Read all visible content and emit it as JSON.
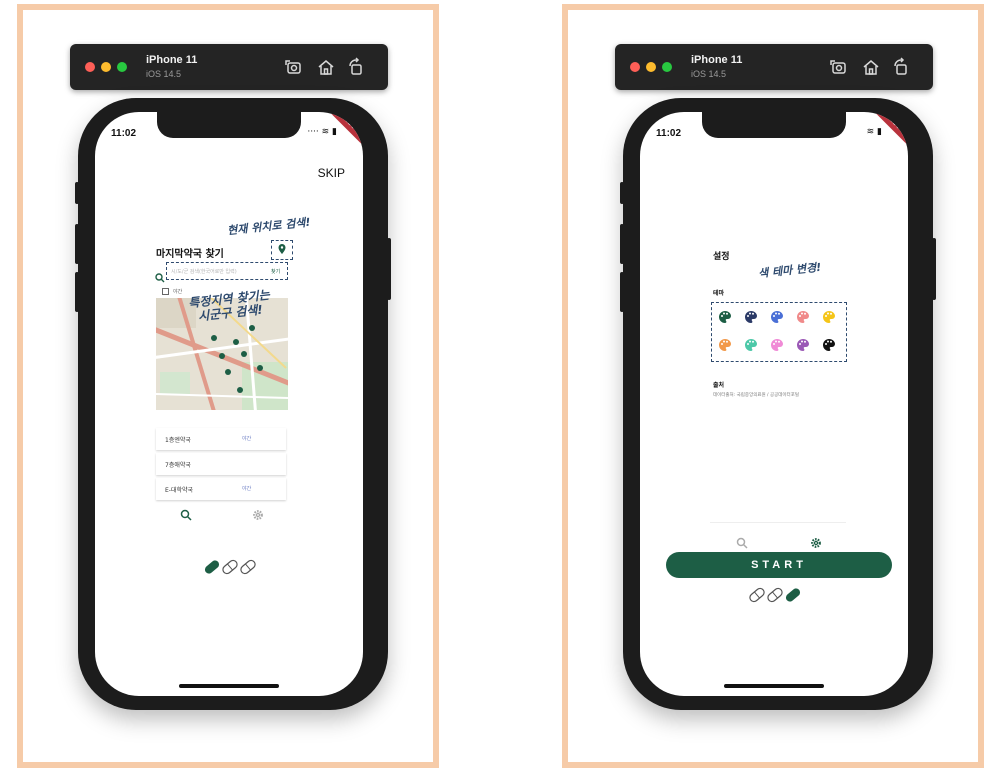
{
  "simulator": {
    "device": "iPhone 11",
    "os": "iOS 14.5"
  },
  "status_bar": {
    "time": "11:02",
    "debug": "DEBUG"
  },
  "screen1": {
    "skip": "SKIP",
    "annot_location": "현재 위치로 검색!",
    "title": "마지막약국 찾기",
    "search": {
      "placeholder": "시/도/군 검색(한국어로만 입력)",
      "button": "찾기"
    },
    "checkbox_label": "야간",
    "annot_region": [
      "특정지역 찾기는",
      "시군구 검색!"
    ],
    "list": [
      {
        "name": "1층엔약국",
        "status": "야간"
      },
      {
        "name": "7층애약국",
        "status": ""
      },
      {
        "name": "E-대학약국",
        "status": "야간"
      }
    ]
  },
  "screen2": {
    "title": "설정",
    "annot_theme": "색 테마 변경!",
    "theme_label": "테마",
    "palettes": [
      "#1d5e45",
      "#2b3a67",
      "#4a6fd6",
      "#f08a8a",
      "#f5c518",
      "#f2994a",
      "#4dc8a8",
      "#f08ad6",
      "#9b59b6",
      "#111111"
    ],
    "source_label": "출처",
    "source_text": "데이터출처: 국립중앙의료원 / 공공데이터포털",
    "start": "START"
  },
  "colors": {
    "brand": "#1d5e45",
    "annotation": "#2e4a6e",
    "frame": "#f6cba8"
  }
}
